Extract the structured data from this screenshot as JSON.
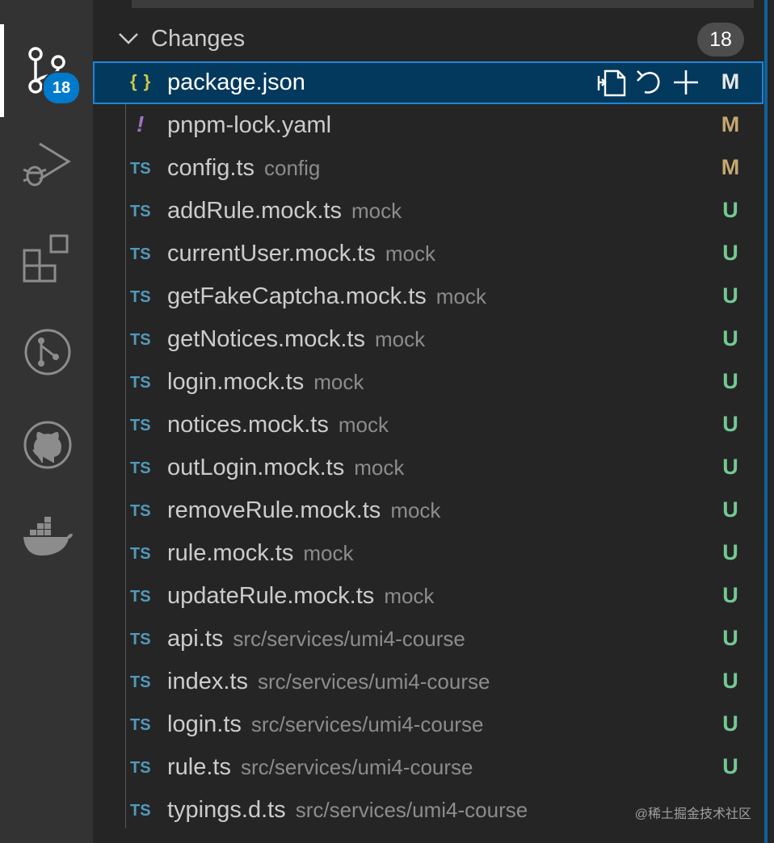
{
  "activity_bar": {
    "items": [
      {
        "name": "source-control-icon",
        "active": true
      },
      {
        "name": "run-debug-icon"
      },
      {
        "name": "extensions-icon"
      },
      {
        "name": "git-graph-icon"
      },
      {
        "name": "github-icon"
      },
      {
        "name": "docker-icon"
      }
    ],
    "source_control_badge": "18"
  },
  "changes": {
    "title": "Changes",
    "count": "18",
    "row_actions": [
      "open-file-icon",
      "discard-changes-icon",
      "stage-changes-icon"
    ],
    "files": [
      {
        "name": "package.json",
        "dir": "",
        "status": "M",
        "icon": "json",
        "selected": true
      },
      {
        "name": "pnpm-lock.yaml",
        "dir": "",
        "status": "M",
        "icon": "yaml"
      },
      {
        "name": "config.ts",
        "dir": "config",
        "status": "M",
        "icon": "ts"
      },
      {
        "name": "addRule.mock.ts",
        "dir": "mock",
        "status": "U",
        "icon": "ts"
      },
      {
        "name": "currentUser.mock.ts",
        "dir": "mock",
        "status": "U",
        "icon": "ts"
      },
      {
        "name": "getFakeCaptcha.mock.ts",
        "dir": "mock",
        "status": "U",
        "icon": "ts"
      },
      {
        "name": "getNotices.mock.ts",
        "dir": "mock",
        "status": "U",
        "icon": "ts"
      },
      {
        "name": "login.mock.ts",
        "dir": "mock",
        "status": "U",
        "icon": "ts"
      },
      {
        "name": "notices.mock.ts",
        "dir": "mock",
        "status": "U",
        "icon": "ts"
      },
      {
        "name": "outLogin.mock.ts",
        "dir": "mock",
        "status": "U",
        "icon": "ts"
      },
      {
        "name": "removeRule.mock.ts",
        "dir": "mock",
        "status": "U",
        "icon": "ts"
      },
      {
        "name": "rule.mock.ts",
        "dir": "mock",
        "status": "U",
        "icon": "ts"
      },
      {
        "name": "updateRule.mock.ts",
        "dir": "mock",
        "status": "U",
        "icon": "ts"
      },
      {
        "name": "api.ts",
        "dir": "src/services/umi4-course",
        "status": "U",
        "icon": "ts"
      },
      {
        "name": "index.ts",
        "dir": "src/services/umi4-course",
        "status": "U",
        "icon": "ts"
      },
      {
        "name": "login.ts",
        "dir": "src/services/umi4-course",
        "status": "U",
        "icon": "ts"
      },
      {
        "name": "rule.ts",
        "dir": "src/services/umi4-course",
        "status": "U",
        "icon": "ts"
      },
      {
        "name": "typings.d.ts",
        "dir": "src/services/umi4-course",
        "status": "",
        "icon": "ts"
      }
    ]
  },
  "watermark": "@稀土掘金技术社区",
  "colors": {
    "accent": "#007acc",
    "modified": "#c5a86f",
    "untracked": "#73c991",
    "ts_icon": "#519aba",
    "json_icon": "#cbcb41",
    "yaml_icon": "#a074c4"
  },
  "icon_glyphs": {
    "ts": "TS",
    "json": "{ }",
    "yaml": "!"
  }
}
